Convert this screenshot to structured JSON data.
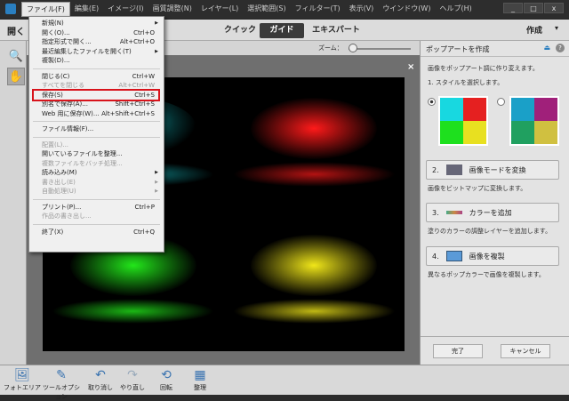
{
  "menubar": {
    "items": [
      "ファイル(F)",
      "編集(E)",
      "イメージ(I)",
      "画質調整(N)",
      "レイヤー(L)",
      "選択範囲(S)",
      "フィルター(T)",
      "表示(V)",
      "ウインドウ(W)",
      "ヘルプ(H)"
    ],
    "window_buttons": [
      "_",
      "□",
      "x"
    ]
  },
  "modebar": {
    "open": "開く",
    "tabs": [
      "クイック",
      "ガイド",
      "エキスパート"
    ],
    "create": "作成",
    "create_arrow": "▾"
  },
  "zoom": {
    "label": "ズーム：",
    "value": "8%"
  },
  "doc_close": "×",
  "file_menu": [
    {
      "label": "新規(N)",
      "shortcut": "",
      "arrow": "▶",
      "disabled": false
    },
    {
      "label": "開く(O)...",
      "shortcut": "Ctrl+O",
      "disabled": false
    },
    {
      "label": "指定形式で開く...",
      "shortcut": "Alt+Ctrl+O",
      "disabled": false
    },
    {
      "label": "最近編集したファイルを開く(T)",
      "shortcut": "",
      "arrow": "▶",
      "disabled": false
    },
    {
      "label": "複製(D)...",
      "shortcut": "",
      "disabled": false
    },
    {
      "sep": true
    },
    {
      "label": "閉じる(C)",
      "shortcut": "Ctrl+W",
      "disabled": false
    },
    {
      "label": "すべてを閉じる",
      "shortcut": "Alt+Ctrl+W",
      "disabled": true
    },
    {
      "label": "保存(S)",
      "shortcut": "Ctrl+S",
      "disabled": false
    },
    {
      "label": "別名で保存(A)...",
      "shortcut": "Shift+Ctrl+S",
      "disabled": false
    },
    {
      "label": "Web 用に保存(W)...",
      "shortcut": "Alt+Shift+Ctrl+S",
      "disabled": false
    },
    {
      "sep": true
    },
    {
      "label": "ファイル情報(F)...",
      "shortcut": "",
      "disabled": false
    },
    {
      "sep": true
    },
    {
      "label": "配置(L)...",
      "shortcut": "",
      "disabled": true
    },
    {
      "label": "開いているファイルを整理...",
      "shortcut": "",
      "disabled": false
    },
    {
      "label": "複数ファイルをバッチ処理...",
      "shortcut": "",
      "disabled": true
    },
    {
      "label": "読み込み(M)",
      "shortcut": "",
      "arrow": "▶",
      "disabled": false
    },
    {
      "label": "書き出し(E)",
      "shortcut": "",
      "arrow": "▶",
      "disabled": true
    },
    {
      "label": "自動処理(U)",
      "shortcut": "",
      "arrow": "▶",
      "disabled": true
    },
    {
      "sep": true
    },
    {
      "label": "プリント(P)...",
      "shortcut": "Ctrl+P",
      "disabled": false
    },
    {
      "label": "作品の書き出し...",
      "shortcut": "",
      "disabled": true
    },
    {
      "sep": true
    },
    {
      "label": "終了(X)",
      "shortcut": "Ctrl+Q",
      "disabled": false
    }
  ],
  "panel": {
    "title": "ポップアートを作成",
    "intro": "画像をポップアート調に作り変えます。",
    "step1": "1. スタイルを選択します。",
    "steps": [
      {
        "num": "2.",
        "label": "画像モードを変換",
        "desc": "画像をビットマップに変換します。"
      },
      {
        "num": "3.",
        "label": "カラーを追加",
        "desc": "塗りのカラーの調整レイヤーを追加します。"
      },
      {
        "num": "4.",
        "label": "画像を複製",
        "desc": "異なるポップカラーで画像を複製します。"
      }
    ],
    "done": "完了",
    "cancel": "キャンセル"
  },
  "bottombar": [
    {
      "label": "フォトエリア",
      "icon": "🖼"
    },
    {
      "label": "ツールオプション",
      "icon": "✎"
    },
    {
      "label": "取り消し",
      "icon": "↶"
    },
    {
      "label": "やり直し",
      "icon": "↷"
    },
    {
      "label": "回転",
      "icon": "⟲"
    },
    {
      "label": "整理",
      "icon": "▦"
    }
  ],
  "colors": {
    "highlight": "#d8131b",
    "quadrants": [
      "#19e0e6",
      "#ff1a1a",
      "#22e61a",
      "#f0e619"
    ]
  }
}
